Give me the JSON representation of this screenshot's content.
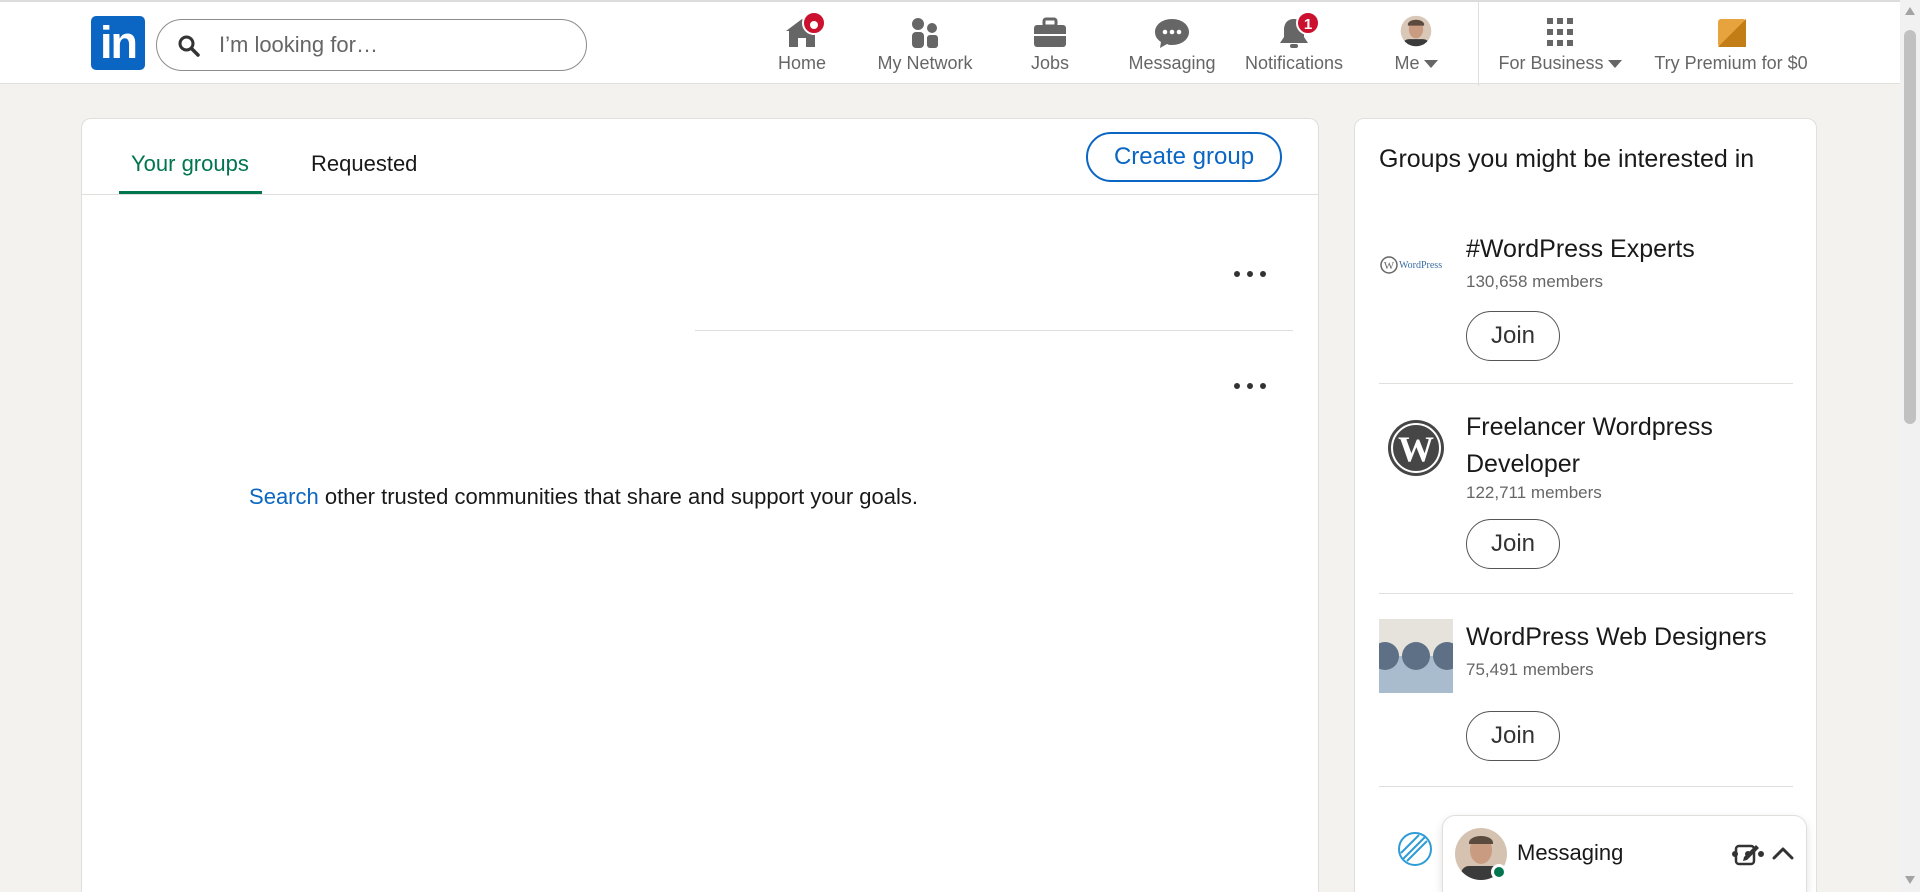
{
  "nav": {
    "logo_text": "in",
    "search_placeholder": "I’m looking for…",
    "items": [
      {
        "label": "Home",
        "icon": "home-icon",
        "badge": ""
      },
      {
        "label": "My Network",
        "icon": "people-icon",
        "badge": ""
      },
      {
        "label": "Jobs",
        "icon": "briefcase-icon",
        "badge": ""
      },
      {
        "label": "Messaging",
        "icon": "chat-icon",
        "badge": ""
      },
      {
        "label": "Notifications",
        "icon": "bell-icon",
        "badge": "1"
      },
      {
        "label": "Me",
        "icon": "avatar",
        "badge": ""
      },
      {
        "label": "For Business",
        "icon": "grid-icon",
        "badge": ""
      },
      {
        "label": "Try Premium for $0",
        "icon": "premium-icon",
        "badge": ""
      }
    ]
  },
  "groups_page": {
    "tabs": [
      {
        "label": "Your groups",
        "active": true
      },
      {
        "label": "Requested",
        "active": false
      }
    ],
    "create_label": "Create group",
    "empty_link": "Search",
    "empty_text": " other trusted communities that share and support your goals."
  },
  "suggestions": {
    "title": "Groups you might be interested in",
    "groups": [
      {
        "name": "#WordPress Experts",
        "members": "130,658 members",
        "join": "Join",
        "thumb": "wordpress-logo"
      },
      {
        "name": "Freelancer Wordpress Developer",
        "members": "122,711 members",
        "join": "Join",
        "thumb": "wordpress-logo"
      },
      {
        "name": "WordPress Web Designers",
        "members": "75,491 members",
        "join": "Join",
        "thumb": "circles-pattern"
      }
    ]
  },
  "messaging": {
    "label": "Messaging"
  },
  "colors": {
    "brand_blue": "#0a66c2",
    "active_green": "#01754f",
    "badge_red": "#cb112d",
    "page_bg": "#f4f2ee"
  }
}
